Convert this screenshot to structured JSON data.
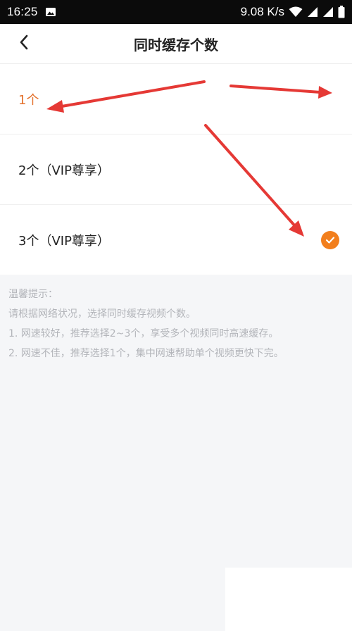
{
  "status_bar": {
    "time": "16:25",
    "network_speed": "9.08 K/s",
    "icons": [
      "image-icon",
      "wifi-icon",
      "signal-icon",
      "signal-icon-2",
      "battery-icon"
    ]
  },
  "header": {
    "title": "同时缓存个数",
    "back_icon": "back-chevron-icon"
  },
  "options": [
    {
      "label": "1个",
      "selected_color": "#e4722e"
    },
    {
      "label": "2个（VIP尊享）"
    },
    {
      "label": "3个（VIP尊享）",
      "checked": true
    }
  ],
  "tips": {
    "heading": "温馨提示：",
    "lines": [
      "请根据网络状况，选择同时缓存视频个数。",
      "1. 网速较好，推荐选择2~3个，享受多个视频同时高速缓存。",
      "2. 网速不佳，推荐选择1个，集中网速帮助单个视频更快下完。"
    ]
  },
  "colors": {
    "accent": "#f27f1d",
    "annotation_arrow": "#e53935",
    "tips_text": "#b3b5ba",
    "tips_bg": "#f5f6f8"
  }
}
